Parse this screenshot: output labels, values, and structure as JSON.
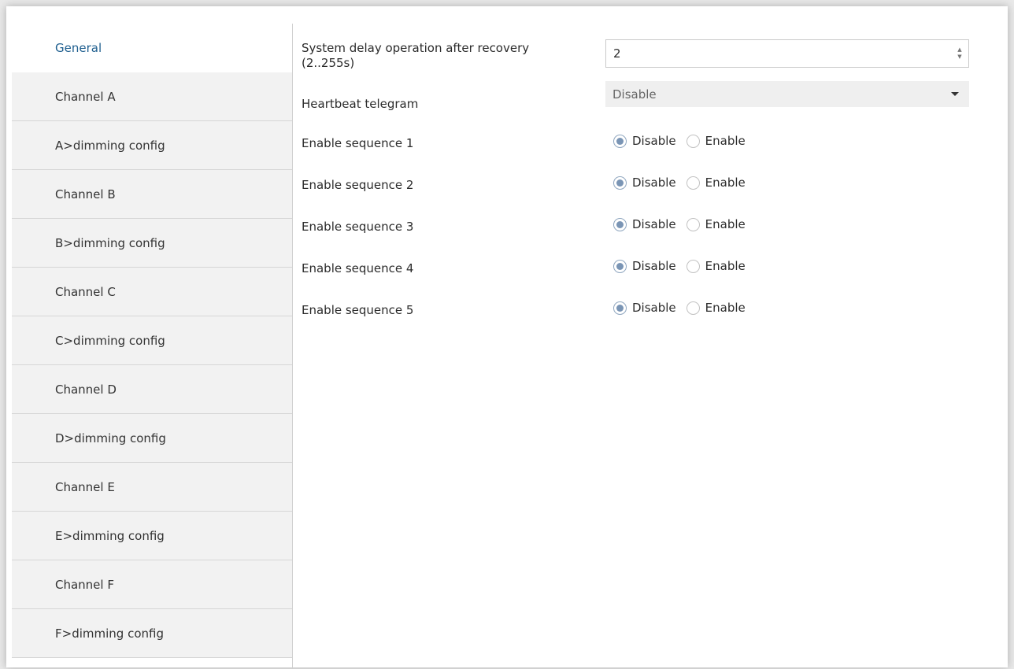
{
  "sidebar": {
    "items": [
      {
        "label": "General",
        "active": true
      },
      {
        "label": "Channel A"
      },
      {
        "label": "A>dimming config"
      },
      {
        "label": "Channel B"
      },
      {
        "label": "B>dimming config"
      },
      {
        "label": "Channel C"
      },
      {
        "label": "C>dimming config"
      },
      {
        "label": "Channel D"
      },
      {
        "label": "D>dimming config"
      },
      {
        "label": "Channel E"
      },
      {
        "label": "E>dimming config"
      },
      {
        "label": "Channel F"
      },
      {
        "label": "F>dimming config"
      }
    ]
  },
  "params": {
    "delay": {
      "label_line1": "System delay operation after recovery",
      "label_line2": "(2..255s)",
      "value": "2",
      "arrow_up": "▲",
      "arrow_down": "▼"
    },
    "heartbeat": {
      "label": "Heartbeat telegram",
      "value": "Disable"
    },
    "sequences": [
      {
        "label": "Enable sequence 1",
        "disable": "Disable",
        "enable": "Enable",
        "selected": "Disable"
      },
      {
        "label": "Enable sequence 2",
        "disable": "Disable",
        "enable": "Enable",
        "selected": "Disable"
      },
      {
        "label": "Enable sequence 3",
        "disable": "Disable",
        "enable": "Enable",
        "selected": "Disable"
      },
      {
        "label": "Enable sequence 4",
        "disable": "Disable",
        "enable": "Enable",
        "selected": "Disable"
      },
      {
        "label": "Enable sequence 5",
        "disable": "Disable",
        "enable": "Enable",
        "selected": "Disable"
      }
    ]
  },
  "colors": {
    "active_nav": "#1f5f8f",
    "radio_checked": "#7a95b5"
  }
}
